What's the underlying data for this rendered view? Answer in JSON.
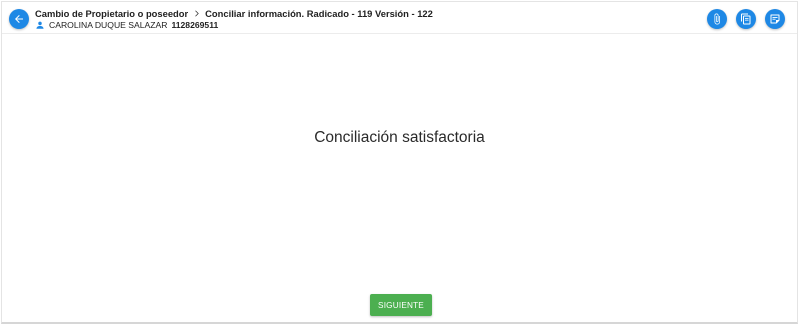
{
  "header": {
    "breadcrumb": {
      "parent": "Cambio de Propietario o poseedor",
      "current": "Conciliar información. Radicado - 119 Versión - 122"
    },
    "user": {
      "name": "CAROLINA DUQUE SALAZAR",
      "id": "1128269511"
    },
    "icons": {
      "back": "arrow-left-icon",
      "user": "person-icon",
      "attach": "paperclip-icon",
      "copy": "copy-documents-icon",
      "notes": "note-icon"
    }
  },
  "main": {
    "message": "Conciliación satisfactoria"
  },
  "footer": {
    "next_label": "SIGUIENTE"
  },
  "colors": {
    "primary": "#1e88e5",
    "success": "#4caf50"
  }
}
